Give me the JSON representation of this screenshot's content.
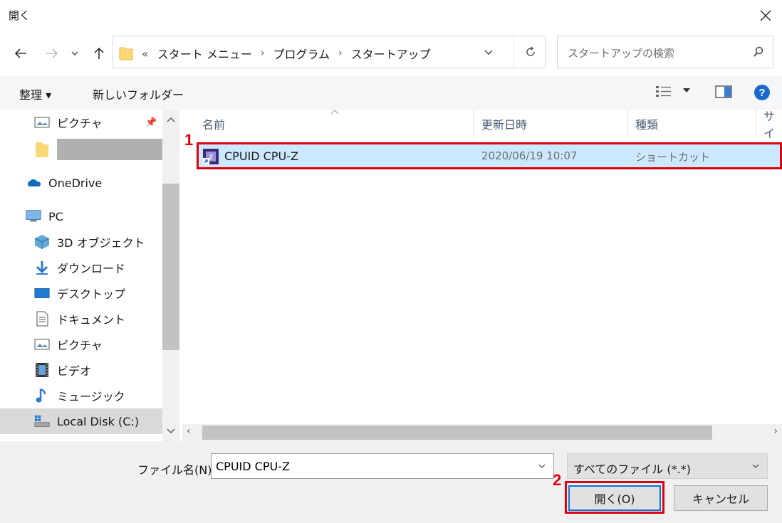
{
  "window": {
    "title": "開く"
  },
  "address": {
    "overflow": "«",
    "crumbs": [
      "スタート メニュー",
      "プログラム",
      "スタートアップ"
    ]
  },
  "search": {
    "placeholder": "スタートアップの検索"
  },
  "toolbar": {
    "organize": "整理 ▾",
    "new_folder": "新しいフォルダー"
  },
  "sidebar": {
    "items": [
      {
        "label": "ピクチャ",
        "icon": "pictures-icon"
      },
      {
        "label": "",
        "icon": "folder-icon"
      },
      {
        "label": "OneDrive",
        "icon": "onedrive-icon"
      },
      {
        "label": "PC",
        "icon": "pc-icon"
      },
      {
        "label": "3D オブジェクト",
        "icon": "3d-objects-icon"
      },
      {
        "label": "ダウンロード",
        "icon": "download-icon"
      },
      {
        "label": "デスクトップ",
        "icon": "desktop-icon"
      },
      {
        "label": "ドキュメント",
        "icon": "documents-icon"
      },
      {
        "label": "ピクチャ",
        "icon": "pictures-icon"
      },
      {
        "label": "ビデオ",
        "icon": "video-icon"
      },
      {
        "label": "ミュージック",
        "icon": "music-icon"
      },
      {
        "label": "Local Disk (C:)",
        "icon": "drive-icon"
      }
    ]
  },
  "columns": [
    "名前",
    "更新日時",
    "種類",
    "サイ"
  ],
  "files": [
    {
      "name": "CPUID CPU-Z",
      "modified": "2020/06/19 10:07",
      "type": "ショートカット"
    }
  ],
  "annotations": {
    "step1": "1",
    "step2": "2"
  },
  "footer": {
    "filename_label": "ファイル名(N):",
    "filename_value": "CPUID CPU-Z",
    "filetype": "すべてのファイル (*.*)",
    "open": "開く(O)",
    "cancel": "キャンセル"
  },
  "colors": {
    "highlight": "#cce8ff",
    "annotation": "#e0000f",
    "accent": "#0078d7"
  }
}
